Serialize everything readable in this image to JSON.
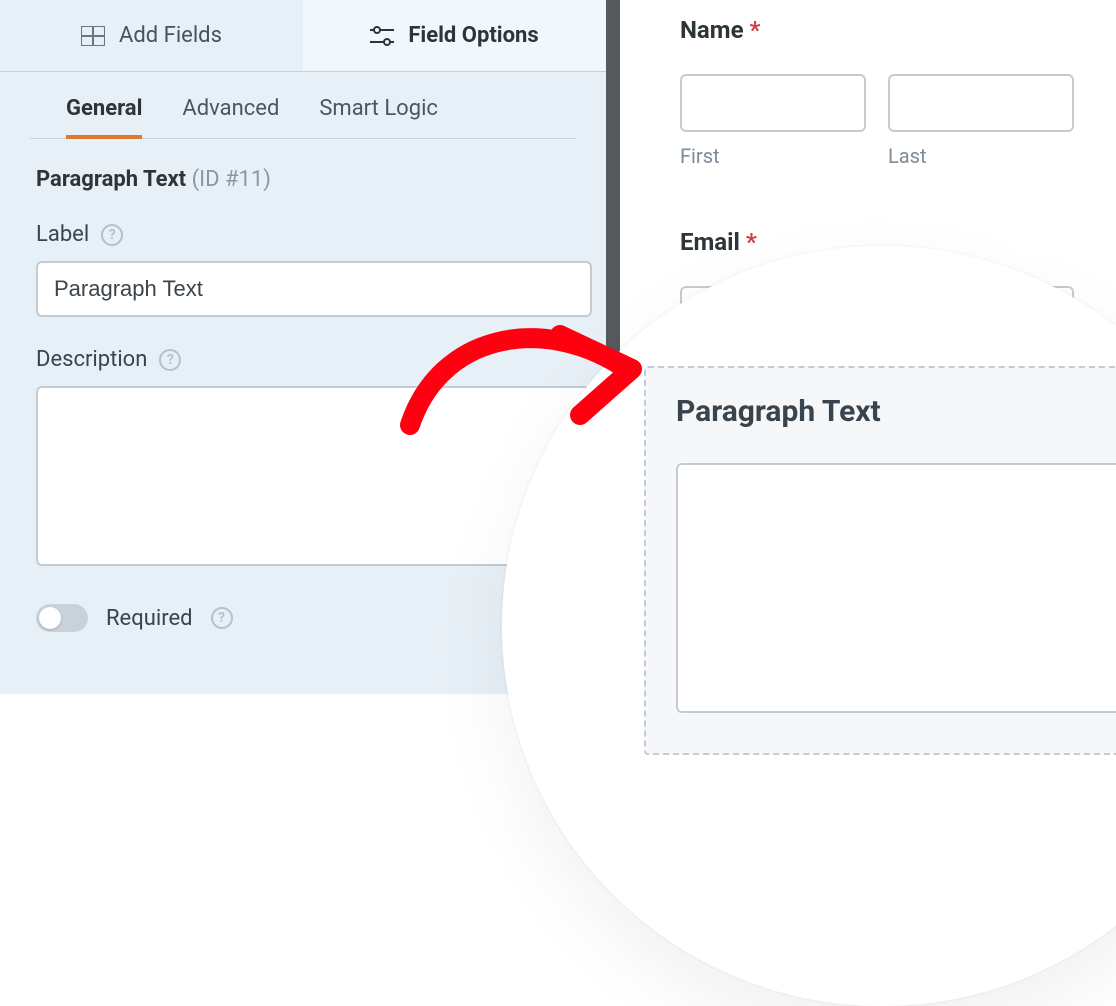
{
  "sidebar": {
    "topTabs": {
      "addFields": "Add Fields",
      "fieldOptions": "Field Options"
    },
    "subTabs": {
      "general": "General",
      "advanced": "Advanced",
      "smartLogic": "Smart Logic"
    },
    "fieldTypeName": "Paragraph Text",
    "fieldIdTag": "(ID #11)",
    "labels": {
      "label": "Label",
      "description": "Description",
      "required": "Required"
    },
    "values": {
      "labelInput": "Paragraph Text",
      "descriptionInput": ""
    },
    "requiredOn": false
  },
  "preview": {
    "nameField": {
      "label": "Name",
      "required": true,
      "subLabels": {
        "first": "First",
        "last": "Last"
      }
    },
    "emailField": {
      "label": "Email",
      "required": true
    },
    "dropTarget": {
      "label": "Paragraph Text"
    }
  },
  "helpGlyph": "?"
}
